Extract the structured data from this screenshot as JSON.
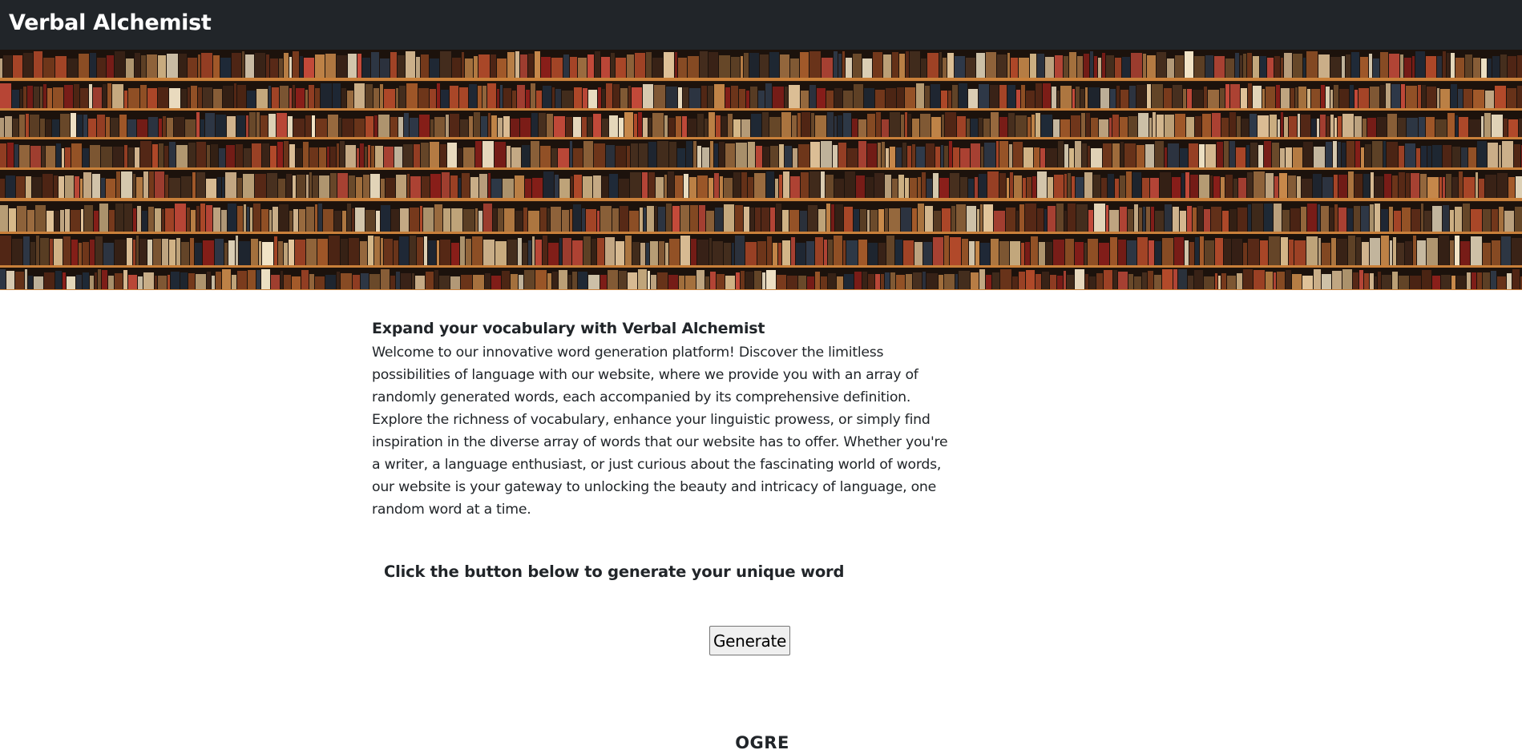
{
  "navbar": {
    "brand": "Verbal Alchemist"
  },
  "banner": {
    "image": "bookshelf-photo"
  },
  "intro": {
    "title": "Expand your vocabulary with Verbal Alchemist",
    "body": "Welcome to our innovative word generation platform! Discover the limitless possibilities of language with our website, where we provide you with an array of randomly generated words, each accompanied by its comprehensive definition. Explore the richness of vocabulary, enhance your linguistic prowess, or simply find inspiration in the diverse array of words that our website has to offer. Whether you're a writer, a language enthusiast, or just curious about the fascinating world of words, our website is your gateway to unlocking the beauty and intricacy of language, one random word at a time."
  },
  "cta": {
    "text": "Click the button below to generate your unique word"
  },
  "generate_button": {
    "label": "Generate"
  },
  "result": {
    "word": "OGRE"
  },
  "colors": {
    "navbar_bg": "#212529",
    "navbar_text": "#ffffff",
    "text": "#212529",
    "button_bg": "#efefef"
  }
}
